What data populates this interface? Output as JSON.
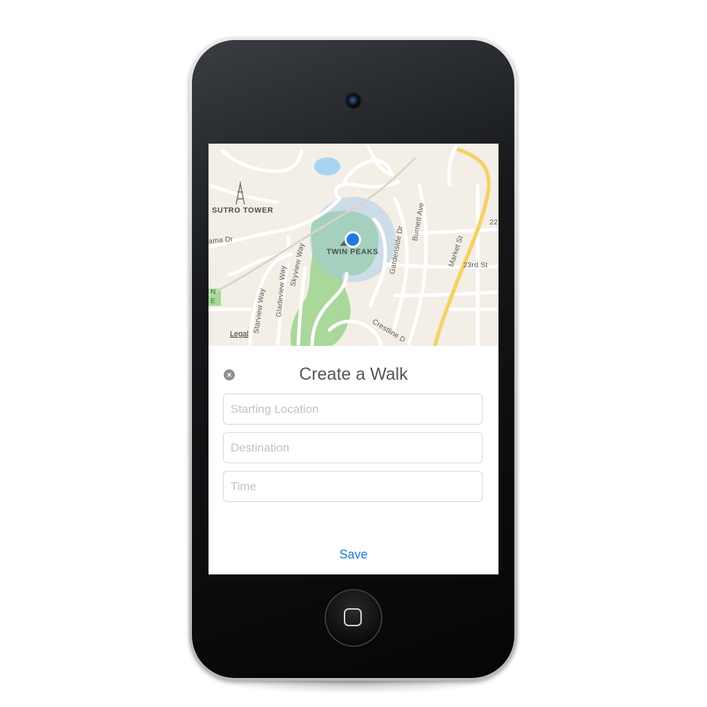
{
  "map": {
    "labels": {
      "sutro_tower": "SUTRO TOWER",
      "twin_peaks": "TWIN PEAKS",
      "ama_dr": "ama Dr",
      "skyview_way": "Skyview Way",
      "gladeview_way": "Gladeview Way",
      "starview_way": "Starview Way",
      "gardenside_dr": "Gardenside Dr",
      "burnett_ave": "Burnett Ave",
      "market_st": "Market St",
      "twentythird_st": "23rd St",
      "crestline": "Crestline D",
      "edge_22": "22",
      "edge_n": "N",
      "edge_e": "E"
    },
    "legal_link": "Legal",
    "colors": {
      "land": "#f3efe6",
      "park": "#a9d89a",
      "water": "#a8d4f3",
      "road": "#ffffff",
      "highway": "#f7d774",
      "location_dot": "#1f7ae0"
    }
  },
  "form": {
    "title": "Create a Walk",
    "close_icon": "close-x-icon",
    "starting_location_placeholder": "Starting Location",
    "destination_placeholder": "Destination",
    "time_placeholder": "Time",
    "save_label": "Save"
  }
}
